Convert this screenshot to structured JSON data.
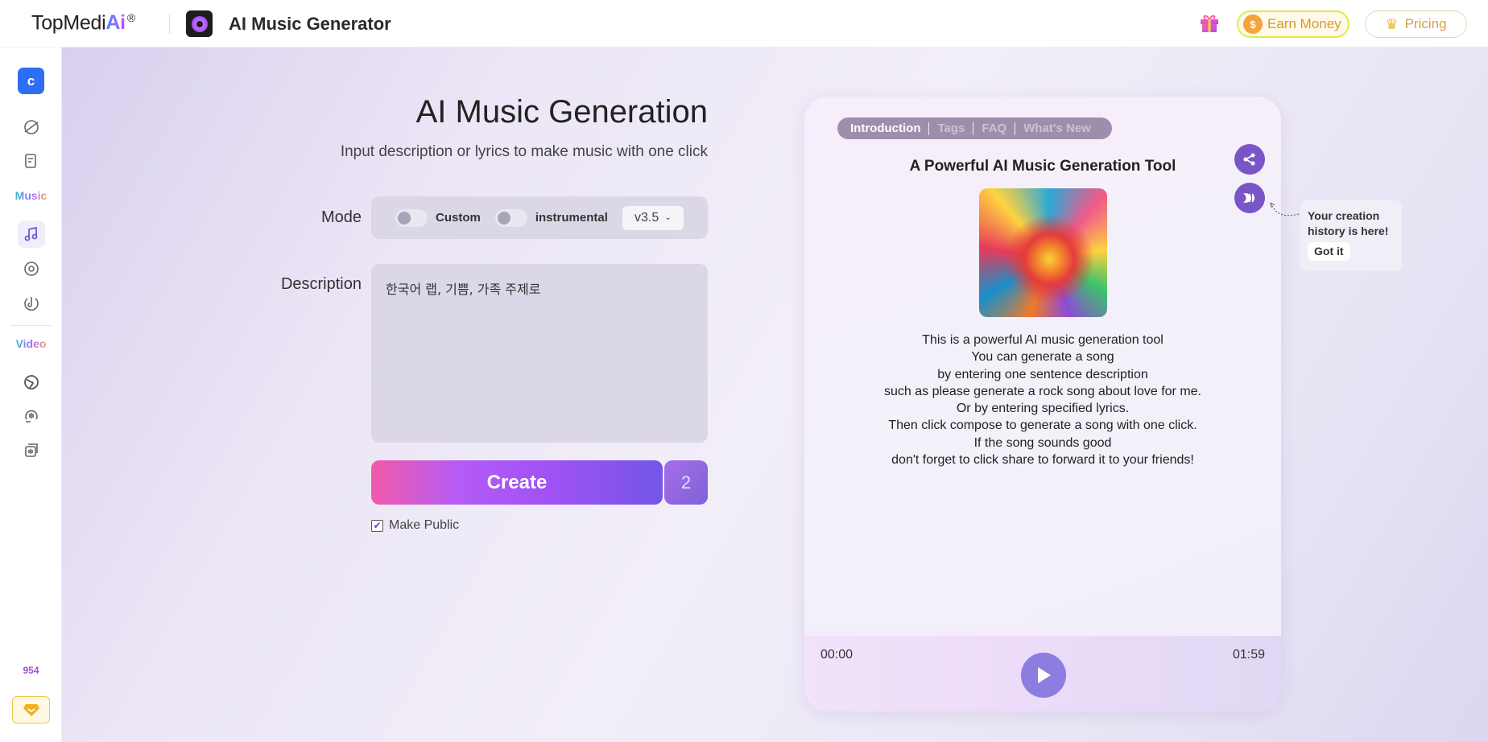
{
  "header": {
    "logo_text": "TopMedi",
    "logo_ai": "Ai",
    "logo_reg": "®",
    "app_title": "AI Music Generator",
    "earn_money": "Earn Money",
    "coin_symbol": "$",
    "pricing": "Pricing"
  },
  "sidebar": {
    "user_initial": "c",
    "music_section": "Music",
    "video_section": "Video",
    "credits": "954"
  },
  "main": {
    "title": "AI Music Generation",
    "subtitle": "Input description or lyrics to make music with one click",
    "mode_label": "Mode",
    "custom_label": "Custom",
    "instrumental_label": "instrumental",
    "custom_on": false,
    "instrumental_on": false,
    "version": "v3.5",
    "description_label": "Description",
    "description_value": "한국어 랩, 기쁨, 가족 주제로",
    "create_label": "Create",
    "create_count": "2",
    "make_public_label": "Make Public",
    "make_public_checked": true
  },
  "card": {
    "tabs": [
      "Introduction",
      "Tags",
      "FAQ",
      "What's New"
    ],
    "active_tab": "Introduction",
    "title": "A Powerful AI Music Generation Tool",
    "lines": [
      "This is a powerful AI music generation tool",
      "You can generate a song",
      "by entering one sentence description",
      "such as please generate a rock song about love for me.",
      "Or by entering specified lyrics.",
      "Then click compose to generate a song with one click.",
      "If the song sounds good",
      "don't forget to click share to forward it to your friends!"
    ],
    "time_current": "00:00",
    "time_total": "01:59"
  },
  "tooltip": {
    "text_line1": "Your creation",
    "text_line2": "history is here!",
    "button": "Got it"
  },
  "colors": {
    "accent": "#7a55c8",
    "create_gradient_start": "#f25aa9",
    "create_gradient_end": "#7356e8",
    "sidebar_user": "#2d6ef5"
  }
}
